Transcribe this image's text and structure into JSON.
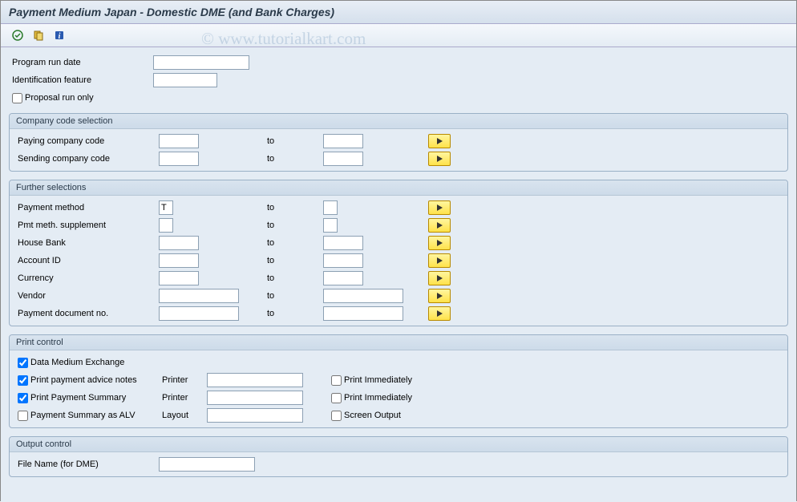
{
  "title": "Payment Medium Japan - Domestic DME (and Bank Charges)",
  "watermark": "© www.tutorialkart.com",
  "top": {
    "program_run_date": {
      "label": "Program run date",
      "value": ""
    },
    "identification_feature": {
      "label": "Identification feature",
      "value": ""
    },
    "proposal_run_only": {
      "label": "Proposal run only",
      "checked": false
    }
  },
  "groups": {
    "company": {
      "title": "Company code selection",
      "rows": [
        {
          "label": "Paying company code",
          "from": "",
          "to_label": "to",
          "to": ""
        },
        {
          "label": "Sending company code",
          "from": "",
          "to_label": "to",
          "to": ""
        }
      ]
    },
    "further": {
      "title": "Further selections",
      "rows": [
        {
          "label": "Payment method",
          "from": "T",
          "to_label": "to",
          "to": "",
          "narrow": true
        },
        {
          "label": "Pmt meth. supplement",
          "from": "",
          "to_label": "to",
          "to": "",
          "narrow": true
        },
        {
          "label": "House Bank",
          "from": "",
          "to_label": "to",
          "to": ""
        },
        {
          "label": "Account ID",
          "from": "",
          "to_label": "to",
          "to": ""
        },
        {
          "label": "Currency",
          "from": "",
          "to_label": "to",
          "to": ""
        },
        {
          "label": "Vendor",
          "from": "",
          "to_label": "to",
          "to": "",
          "wide": true
        },
        {
          "label": "Payment document no.",
          "from": "",
          "to_label": "to",
          "to": "",
          "wide": true
        }
      ]
    },
    "print": {
      "title": "Print control",
      "dme": {
        "label": "Data Medium Exchange",
        "checked": true
      },
      "rows": [
        {
          "cb_label": "Print payment advice notes",
          "cb_checked": true,
          "mid_label": "Printer",
          "mid_value": "",
          "ex_label": "Print Immediately",
          "ex_checked": false
        },
        {
          "cb_label": "Print Payment Summary",
          "cb_checked": true,
          "mid_label": "Printer",
          "mid_value": "",
          "ex_label": "Print Immediately",
          "ex_checked": false
        },
        {
          "cb_label": "Payment Summary as ALV",
          "cb_checked": false,
          "mid_label": "Layout",
          "mid_value": "",
          "ex_label": "Screen Output",
          "ex_checked": false
        }
      ]
    },
    "output": {
      "title": "Output control",
      "file": {
        "label": "File Name (for DME)",
        "value": ""
      }
    }
  }
}
